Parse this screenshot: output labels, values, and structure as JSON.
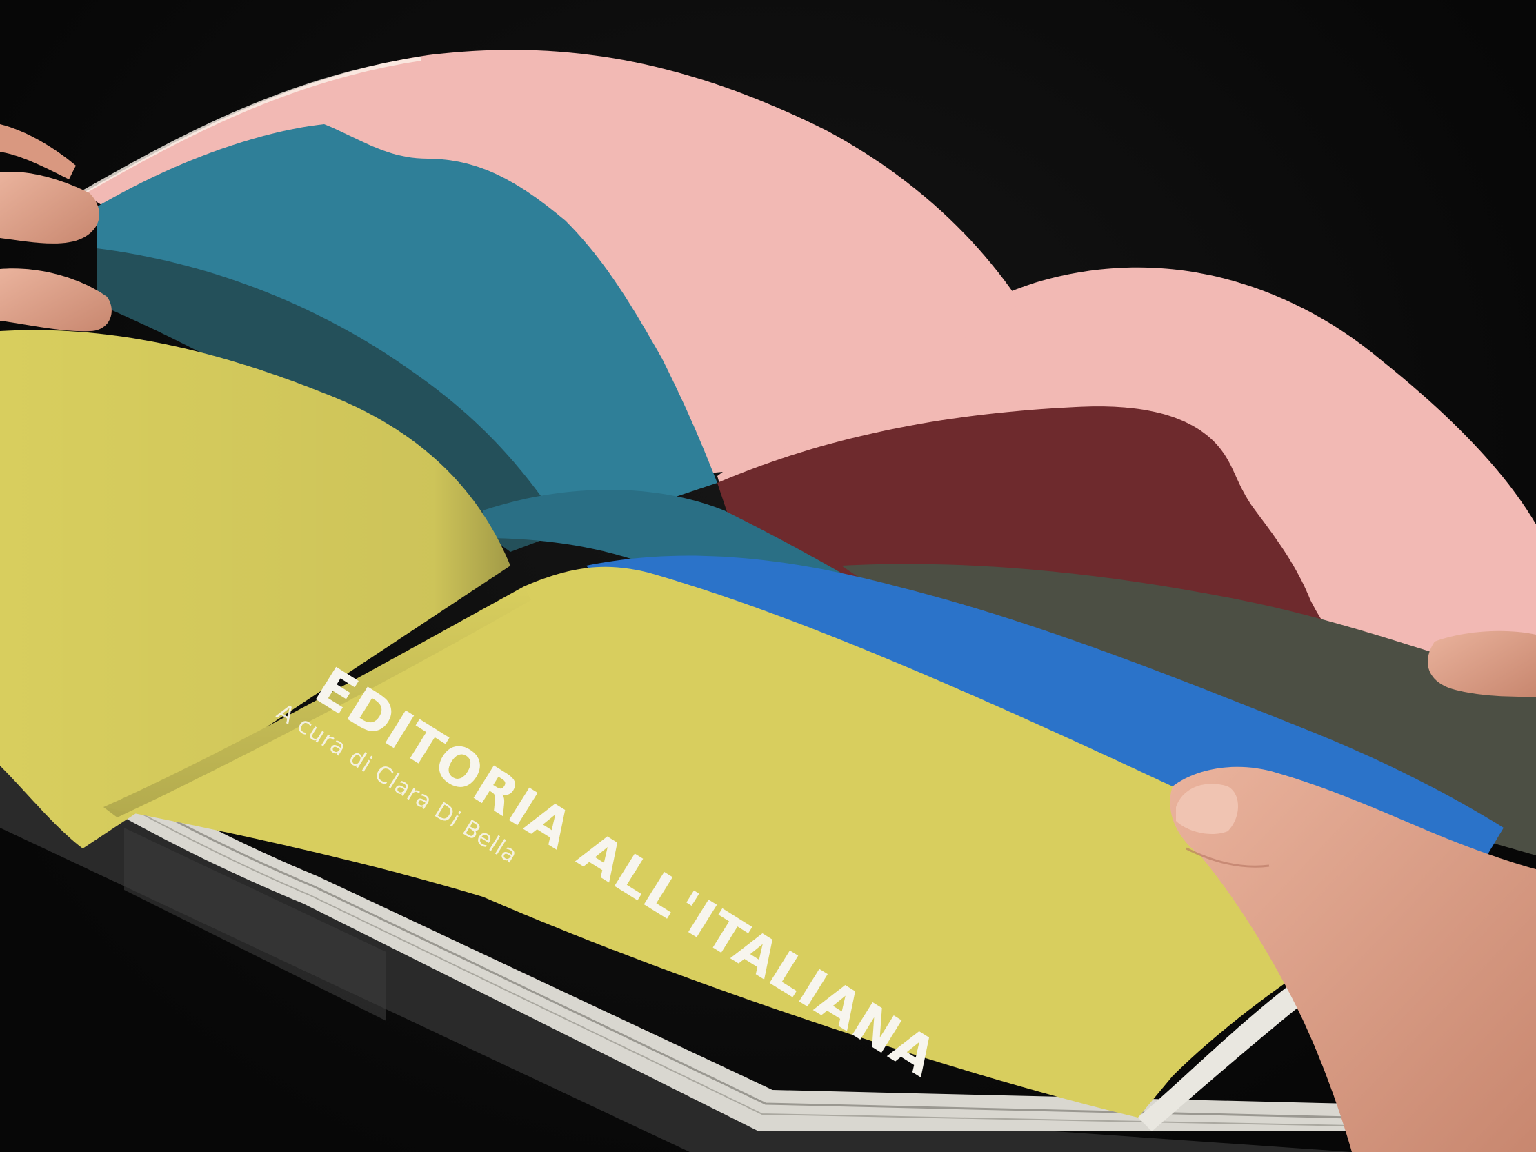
{
  "page": {
    "title": "EDITORIA ALL'ITALIANA",
    "subtitle": "A cura di Clara Di Bella"
  },
  "colors": {
    "background": "#0b0b0b",
    "yellow_page": "#d8ce5e",
    "teal": "#2f7f98",
    "dark_teal": "#24505a",
    "pink": "#f2b9b4",
    "maroon": "#6e2a2d",
    "olive_gray": "#4c4f44",
    "blue": "#2b73c9",
    "paper_edge": "#e9e7e0",
    "skin": "#e3a690"
  },
  "objects": {
    "book": "open-book",
    "hands": [
      "left-hand",
      "right-hand"
    ]
  }
}
